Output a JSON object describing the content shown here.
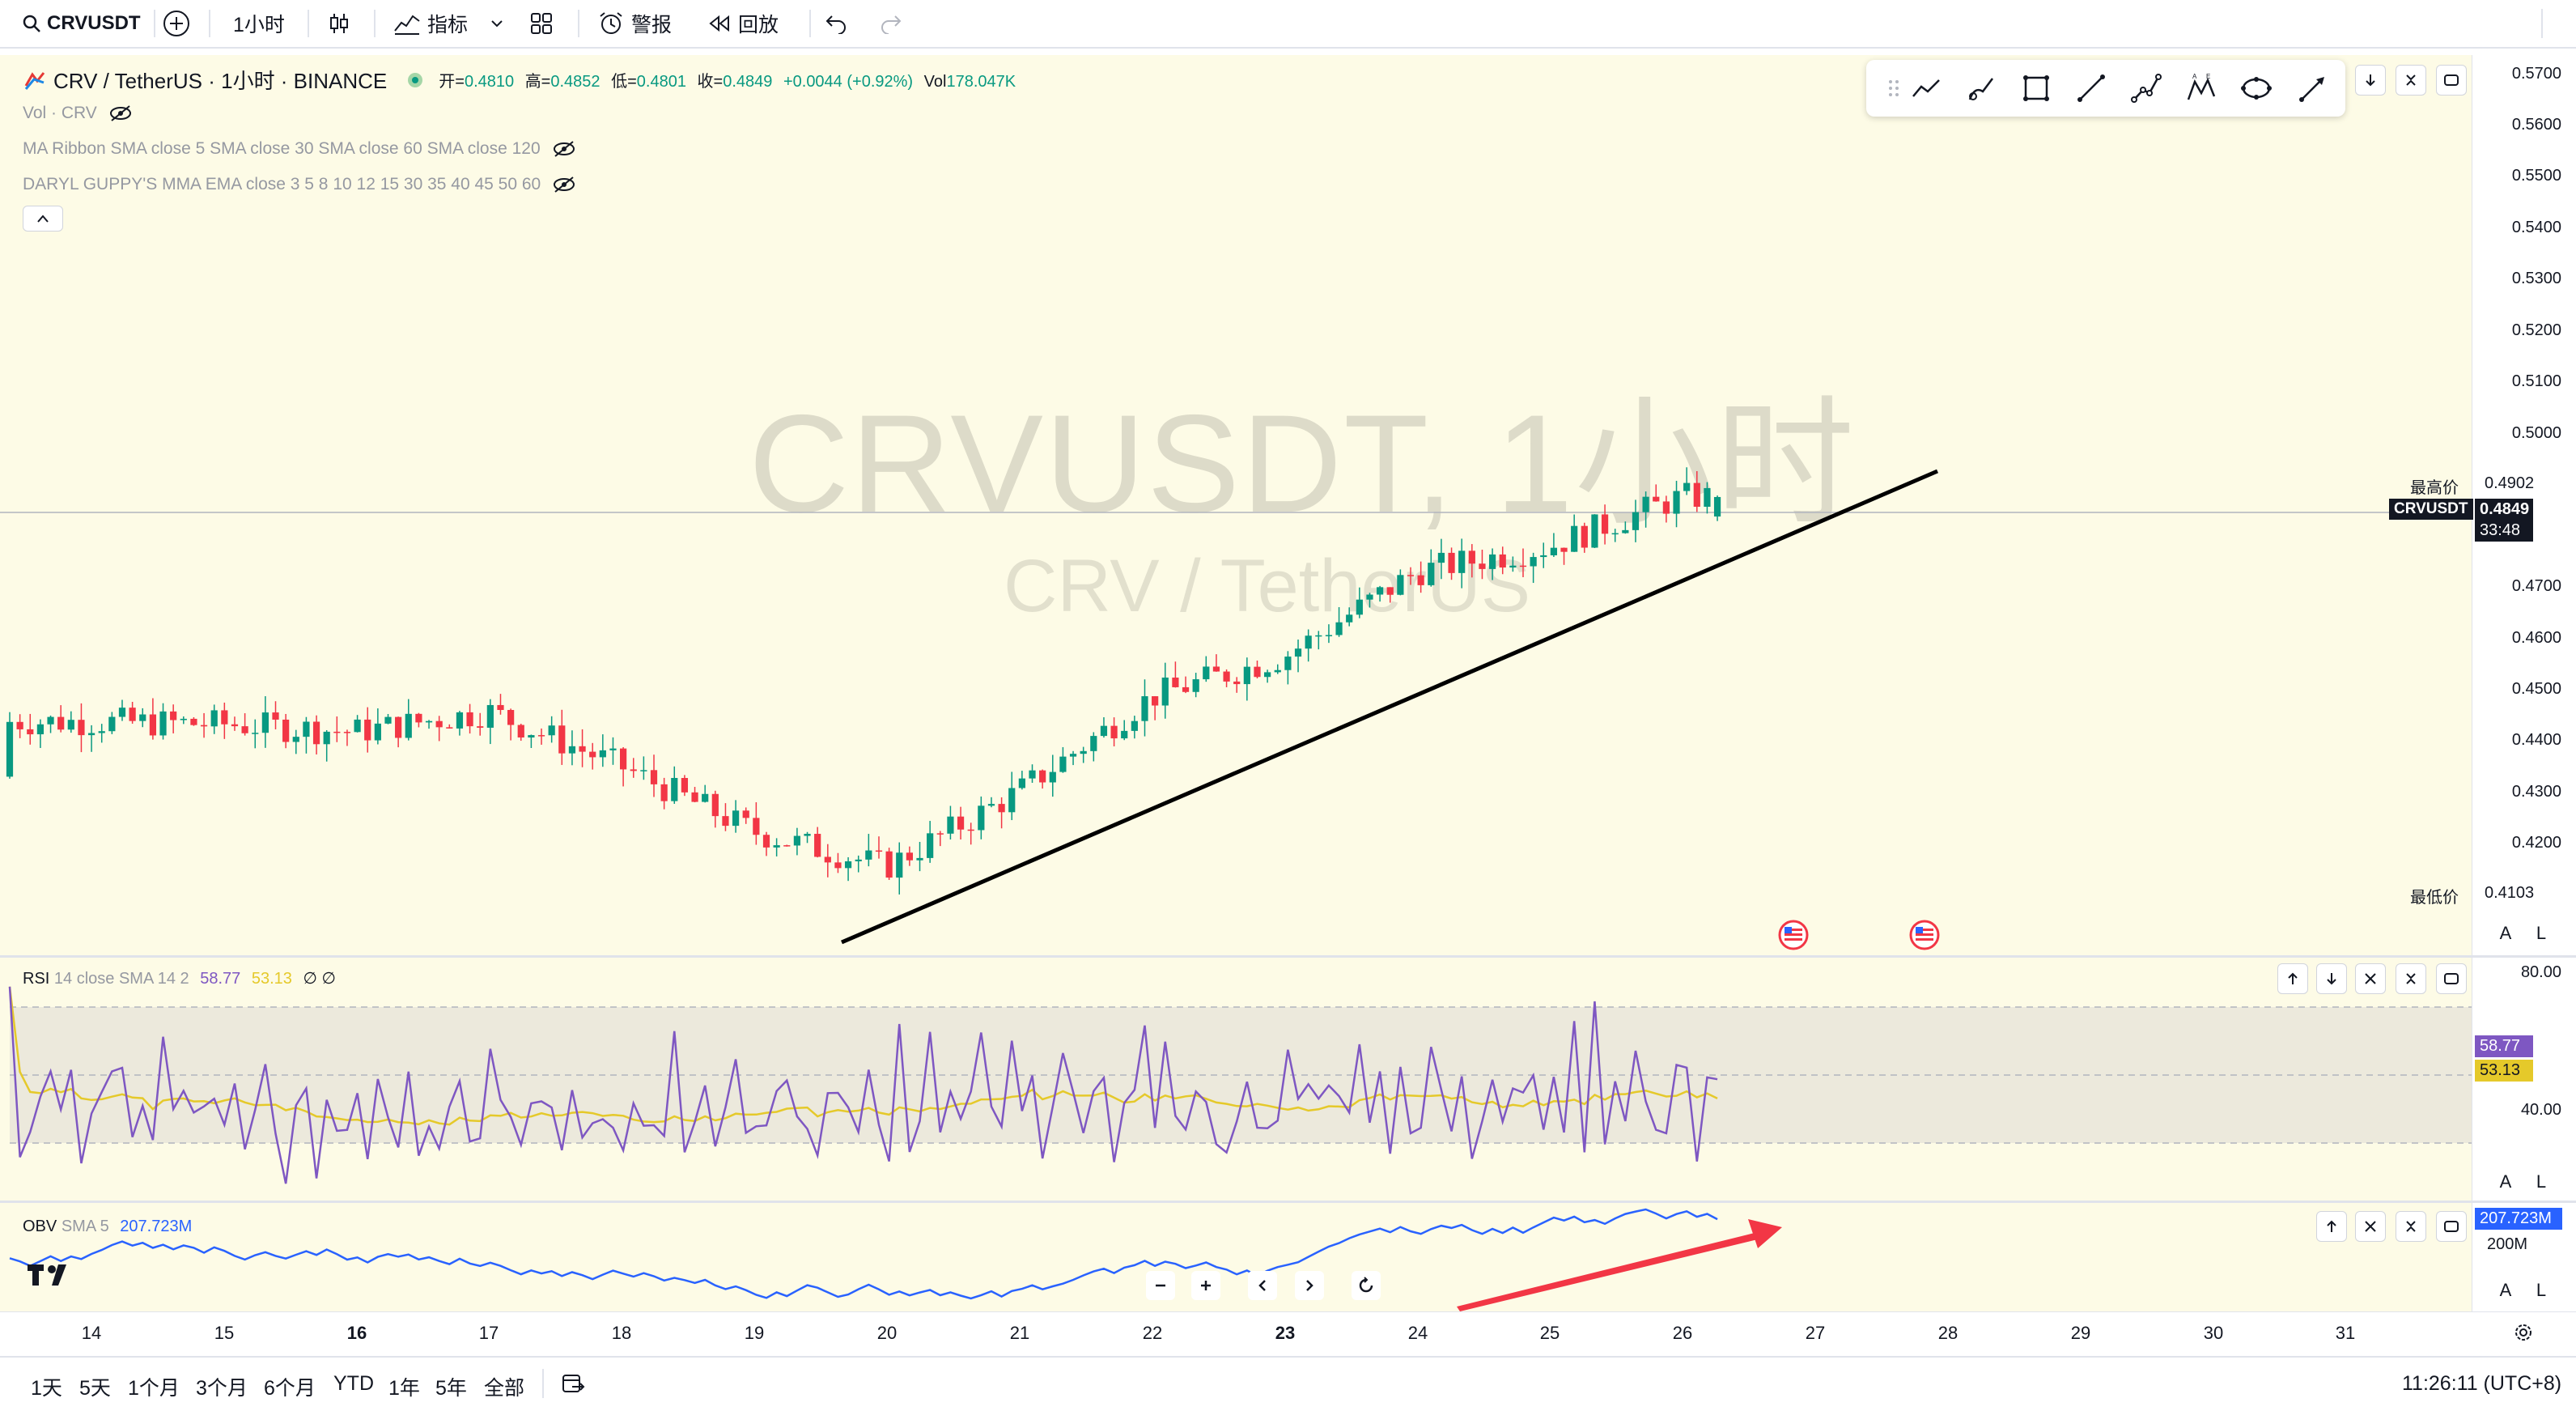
{
  "toolbar": {
    "symbol": "CRVUSDT",
    "add_symbol": "+",
    "interval": "1小时",
    "indicators_label": "指标",
    "alerts_label": "警报",
    "replay_label": "回放"
  },
  "legend": {
    "title": "CRV / TetherUS · 1小时 · BINANCE",
    "open_label": "开=",
    "open": "0.4810",
    "high_label": "高=",
    "high": "0.4852",
    "low_label": "低=",
    "low": "0.4801",
    "close_label": "收=",
    "close": "0.4849",
    "change": "+0.0044 (+0.92%)",
    "vol_label": "Vol",
    "vol": "178.047K",
    "indicators": [
      "Vol · CRV",
      "MA Ribbon SMA close 5 SMA close 30 SMA close 60 SMA close 120",
      "DARYL GUPPY'S MMA EMA close 3 5 8 10 12 15 30 35 40 45 50 60"
    ]
  },
  "watermark": {
    "main": "CRVUSDT, 1小时",
    "sub": "CRV / TetherUS"
  },
  "price_scale": {
    "ticks": [
      "0.5700",
      "0.5600",
      "0.5500",
      "0.5400",
      "0.5300",
      "0.5200",
      "0.5100",
      "0.5000",
      "0.4700",
      "0.4600",
      "0.4500",
      "0.4400",
      "0.4300",
      "0.4200"
    ],
    "high_label": "最高价",
    "high_value": "0.4902",
    "low_label": "最低价",
    "low_value": "0.4103",
    "symbol_tag": "CRVUSDT",
    "last_price": "0.4849",
    "countdown": "33:48",
    "auto_label": "A",
    "log_label": "L"
  },
  "rsi": {
    "title": "RSI",
    "params": "14 close SMA 14 2",
    "value": "58.77",
    "sma_value": "53.13",
    "extra": "∅ ∅",
    "ticks": [
      "80.00",
      "40.00"
    ],
    "colors": {
      "rsi": "#7e57c2",
      "sma": "#e5c92a",
      "band": "#ece9dc"
    }
  },
  "obv": {
    "title": "OBV",
    "params": "SMA 5",
    "value": "207.723M",
    "tick": "200M",
    "color": "#2962ff"
  },
  "time_axis": {
    "labels": [
      "14",
      "15",
      "16",
      "17",
      "18",
      "19",
      "20",
      "21",
      "22",
      "23",
      "24",
      "25",
      "26",
      "27",
      "28",
      "29",
      "30",
      "31"
    ],
    "bold": [
      "16",
      "23"
    ]
  },
  "bottom_bar": {
    "ranges": [
      "1天",
      "5天",
      "1个月",
      "3个月",
      "6个月",
      "YTD",
      "1年",
      "5年",
      "全部"
    ],
    "clock": "11:26:11 (UTC+8)"
  },
  "chart_data": {
    "type": "candlestick",
    "symbol": "CRVUSDT",
    "interval": "1小时",
    "exchange": "BINANCE",
    "x_dates": [
      "14",
      "15",
      "16",
      "17",
      "18",
      "19",
      "20",
      "21",
      "22",
      "23",
      "24",
      "25",
      "26"
    ],
    "approx_close_by_day": [
      0.44,
      0.4395,
      0.438,
      0.442,
      0.431,
      0.418,
      0.411,
      0.426,
      0.445,
      0.453,
      0.47,
      0.475,
      0.4849
    ],
    "ylim": [
      0.4103,
      0.57
    ],
    "high": 0.4902,
    "low": 0.4103,
    "last": 0.4849,
    "rsi_last": 58.77,
    "rsi_sma_last": 53.13,
    "rsi_band": [
      40,
      80
    ],
    "obv_last_millions": 207.723,
    "colors": {
      "up": "#089981",
      "down": "#f23645",
      "trendline": "#000000",
      "arrow": "#f23645"
    }
  }
}
